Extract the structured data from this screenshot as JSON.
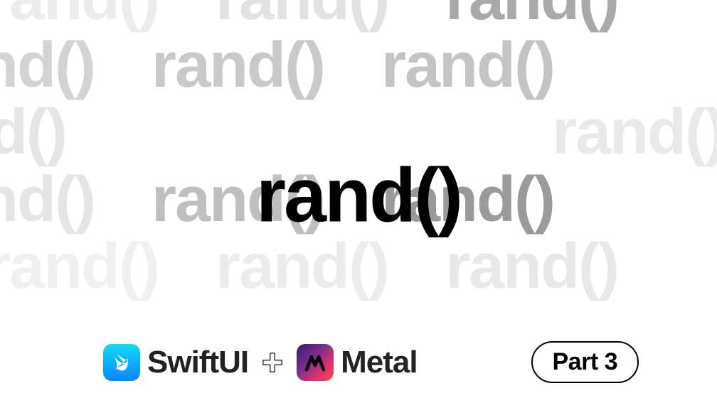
{
  "main_title": "rand()",
  "bg_word": "rand()",
  "bg_rows": [
    [
      {
        "offset": 60,
        "color": "#ececec"
      },
      {
        "offset": 0,
        "color": "#e2e2e2"
      },
      {
        "offset": 0,
        "color": "#a9a9a9"
      }
    ],
    [
      {
        "offset": -30,
        "color": "#d3d3d3"
      },
      {
        "offset": 0,
        "color": "#c9c9c9"
      },
      {
        "offset": 0,
        "color": "#c4c4c4"
      }
    ],
    [
      {
        "offset": -70,
        "color": "#e5e5e5"
      },
      {
        "offset": 280,
        "color": "transparent"
      },
      {
        "offset": 0,
        "color": "#e9e9e9"
      }
    ],
    [
      {
        "offset": -30,
        "color": "#e5e5e5"
      },
      {
        "offset": 0,
        "color": "#bfbfbf"
      },
      {
        "offset": 0,
        "color": "#9a9a9a"
      }
    ],
    [
      {
        "offset": 60,
        "color": "#f0f0f0"
      },
      {
        "offset": 0,
        "color": "#ececec"
      },
      {
        "offset": 0,
        "color": "#e8e8e8"
      }
    ]
  ],
  "tech": {
    "swiftui_label": "SwiftUI",
    "metal_label": "Metal"
  },
  "part_badge": "Part 3"
}
